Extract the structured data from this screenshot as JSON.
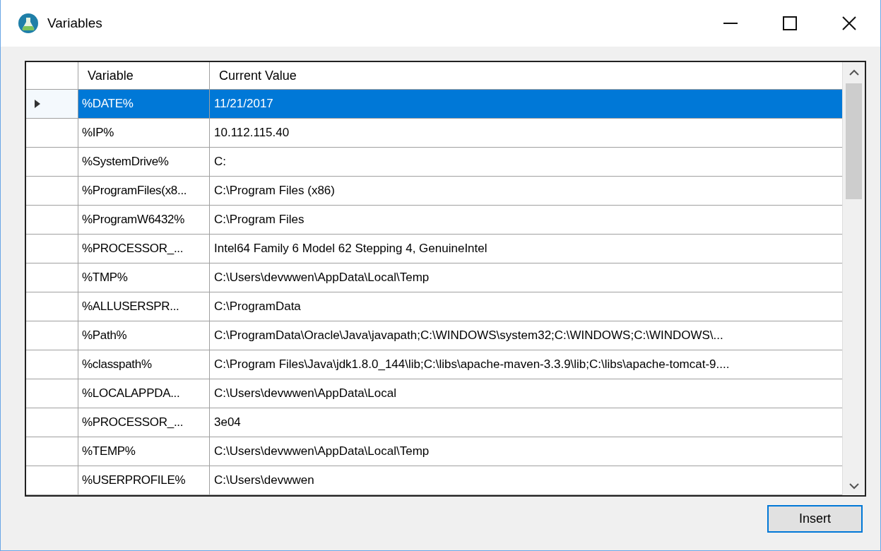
{
  "window": {
    "title": "Variables"
  },
  "table": {
    "columns": [
      "Variable",
      "Current Value"
    ],
    "rows": [
      {
        "variable": "%DATE%",
        "value": "11/21/2017",
        "selected": true
      },
      {
        "variable": "%IP%",
        "value": "10.112.115.40",
        "selected": false
      },
      {
        "variable": "%SystemDrive%",
        "value": "C:",
        "selected": false
      },
      {
        "variable": "%ProgramFiles(x8...",
        "value": "C:\\Program Files (x86)",
        "selected": false
      },
      {
        "variable": "%ProgramW6432%",
        "value": "C:\\Program Files",
        "selected": false
      },
      {
        "variable": "%PROCESSOR_...",
        "value": "Intel64 Family 6 Model 62 Stepping 4, GenuineIntel",
        "selected": false
      },
      {
        "variable": "%TMP%",
        "value": "C:\\Users\\devwwen\\AppData\\Local\\Temp",
        "selected": false
      },
      {
        "variable": "%ALLUSERSPR...",
        "value": "C:\\ProgramData",
        "selected": false
      },
      {
        "variable": "%Path%",
        "value": "C:\\ProgramData\\Oracle\\Java\\javapath;C:\\WINDOWS\\system32;C:\\WINDOWS;C:\\WINDOWS\\...",
        "selected": false
      },
      {
        "variable": "%classpath%",
        "value": "C:\\Program Files\\Java\\jdk1.8.0_144\\lib;C:\\libs\\apache-maven-3.3.9\\lib;C:\\libs\\apache-tomcat-9....",
        "selected": false
      },
      {
        "variable": "%LOCALAPPDA...",
        "value": "C:\\Users\\devwwen\\AppData\\Local",
        "selected": false
      },
      {
        "variable": "%PROCESSOR_...",
        "value": "3e04",
        "selected": false
      },
      {
        "variable": "%TEMP%",
        "value": "C:\\Users\\devwwen\\AppData\\Local\\Temp",
        "selected": false
      },
      {
        "variable": "%USERPROFILE%",
        "value": "C:\\Users\\devwwen",
        "selected": false
      }
    ]
  },
  "buttons": [
    "Insert"
  ]
}
